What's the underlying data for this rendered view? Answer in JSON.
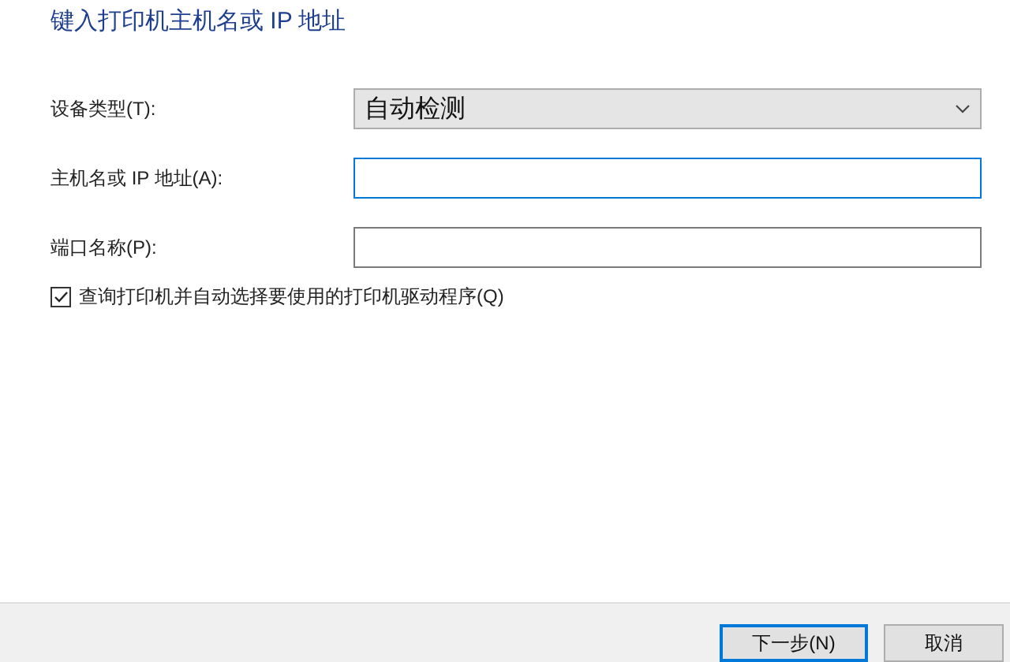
{
  "heading": "键入打印机主机名或 IP 地址",
  "fields": [
    {
      "kind": "dropdown",
      "label": "设备类型(T):",
      "value": "自动检测",
      "focused": false
    },
    {
      "kind": "text",
      "label": "主机名或 IP 地址(A):",
      "focused": true
    },
    {
      "kind": "text",
      "label": "端口名称(P):",
      "focused": false
    }
  ],
  "checkbox": {
    "label": "查询打印机并自动选择要使用的打印机驱动程序(Q)",
    "checked": true
  },
  "buttons": [
    {
      "label": "下一步(N)",
      "default": true
    },
    {
      "label": "取消",
      "default": false
    }
  ]
}
